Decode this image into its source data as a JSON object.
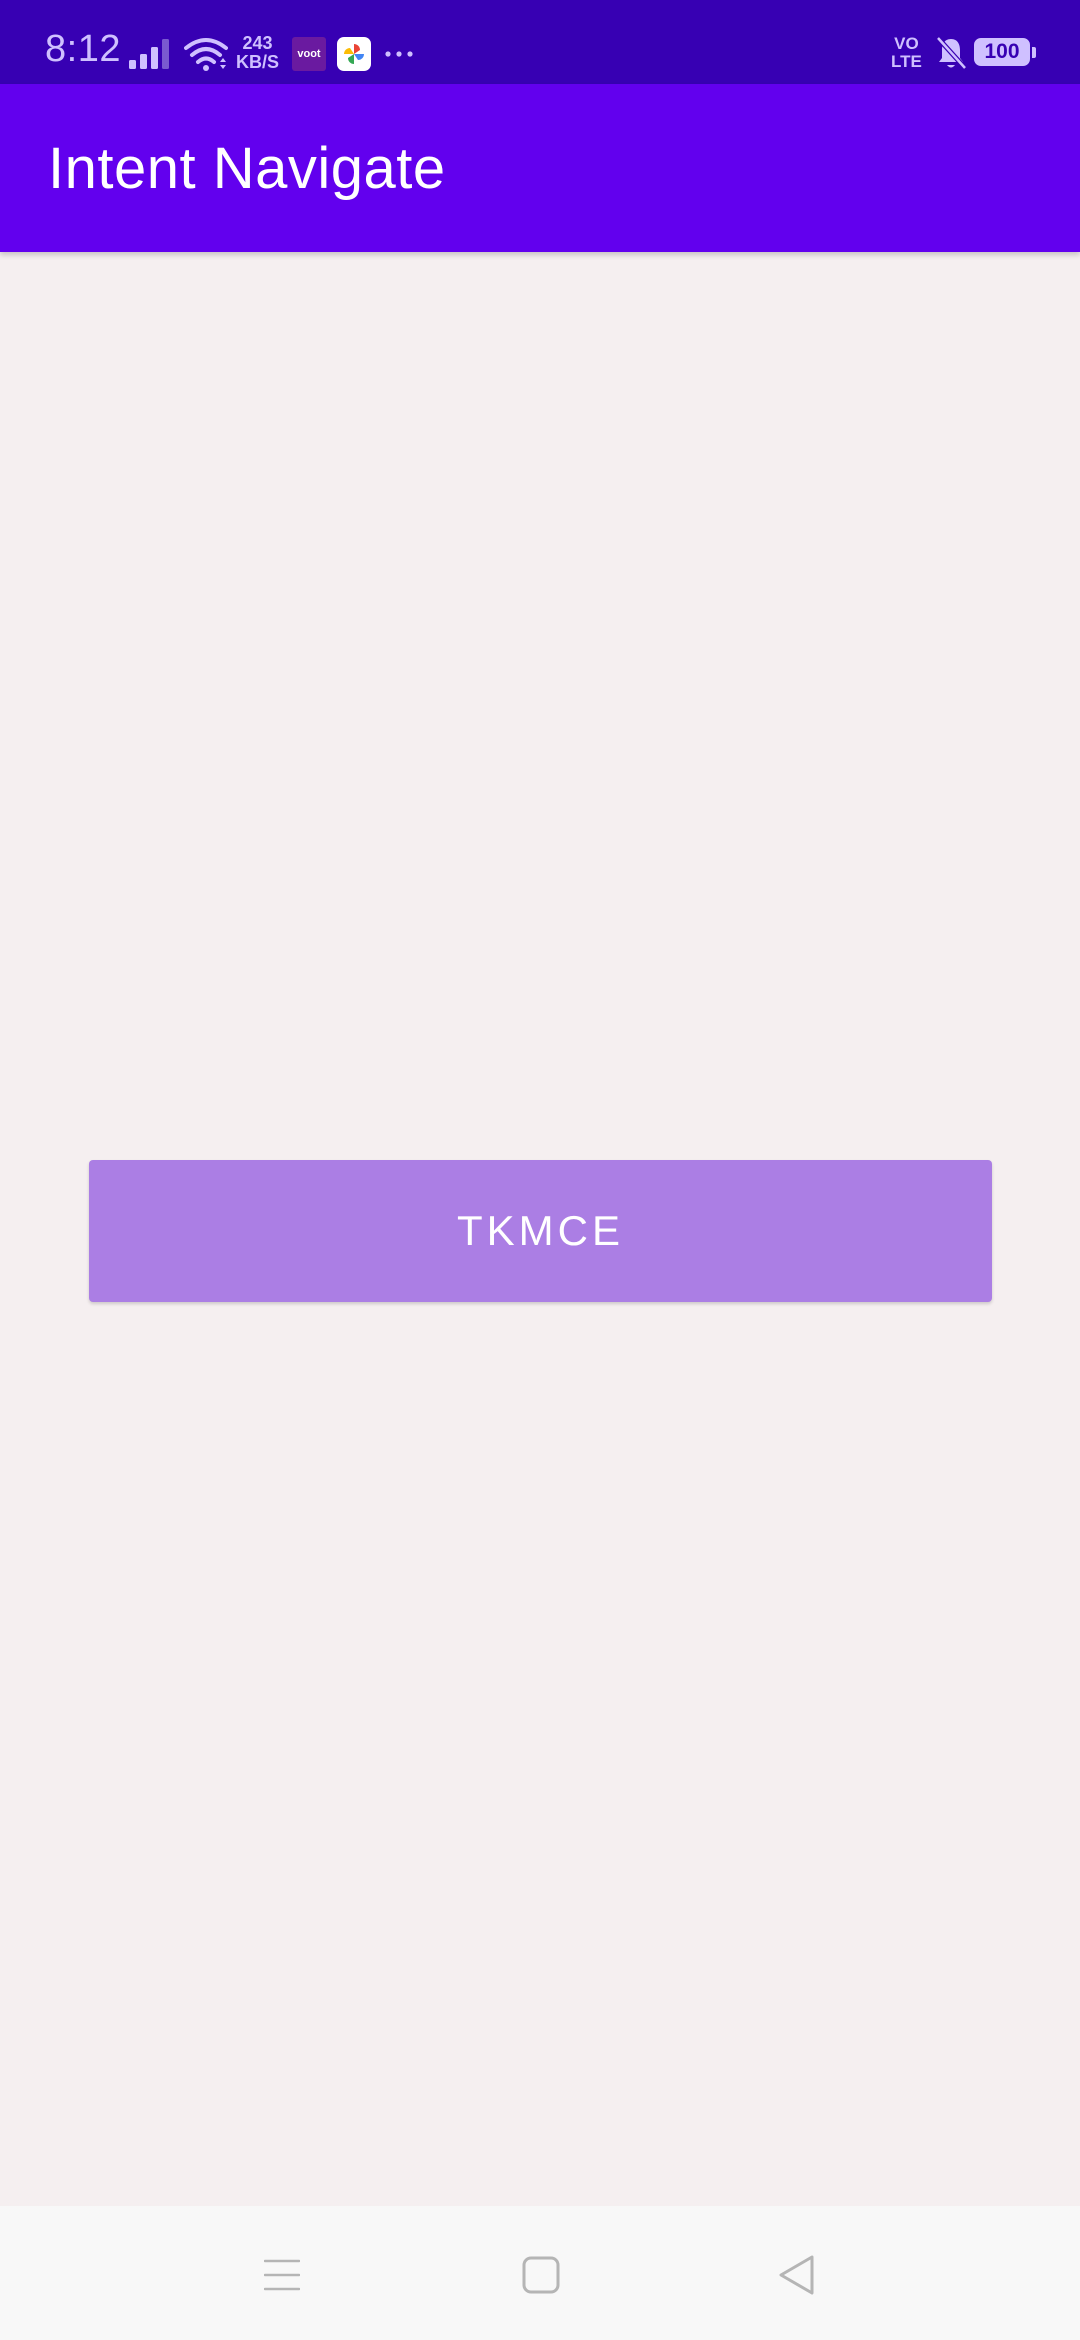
{
  "status_bar": {
    "time": "8:12",
    "net_speed_value": "243",
    "net_speed_unit": "KB/S",
    "voot_label": "voot",
    "volte_top": "VO",
    "volte_bottom": "LTE",
    "battery_level": "100",
    "icons": {
      "signal": "signal-icon",
      "wifi": "wifi-icon",
      "voot": "voot-app-icon",
      "photos": "photos-app-icon",
      "more": "more-icon",
      "bell": "bell-off-icon",
      "battery": "battery-icon"
    },
    "colors": {
      "background": "#3700b3",
      "foreground": "#cfc0ff"
    }
  },
  "app_bar": {
    "title": "Intent Navigate",
    "color": "#6200ee"
  },
  "main": {
    "button_label": "TKMCE",
    "button_color": "#ab7ee4",
    "background": "#f5eff0"
  },
  "nav_bar": {
    "icons": {
      "menu": "menu-icon",
      "home": "home-icon",
      "back": "back-icon"
    }
  }
}
